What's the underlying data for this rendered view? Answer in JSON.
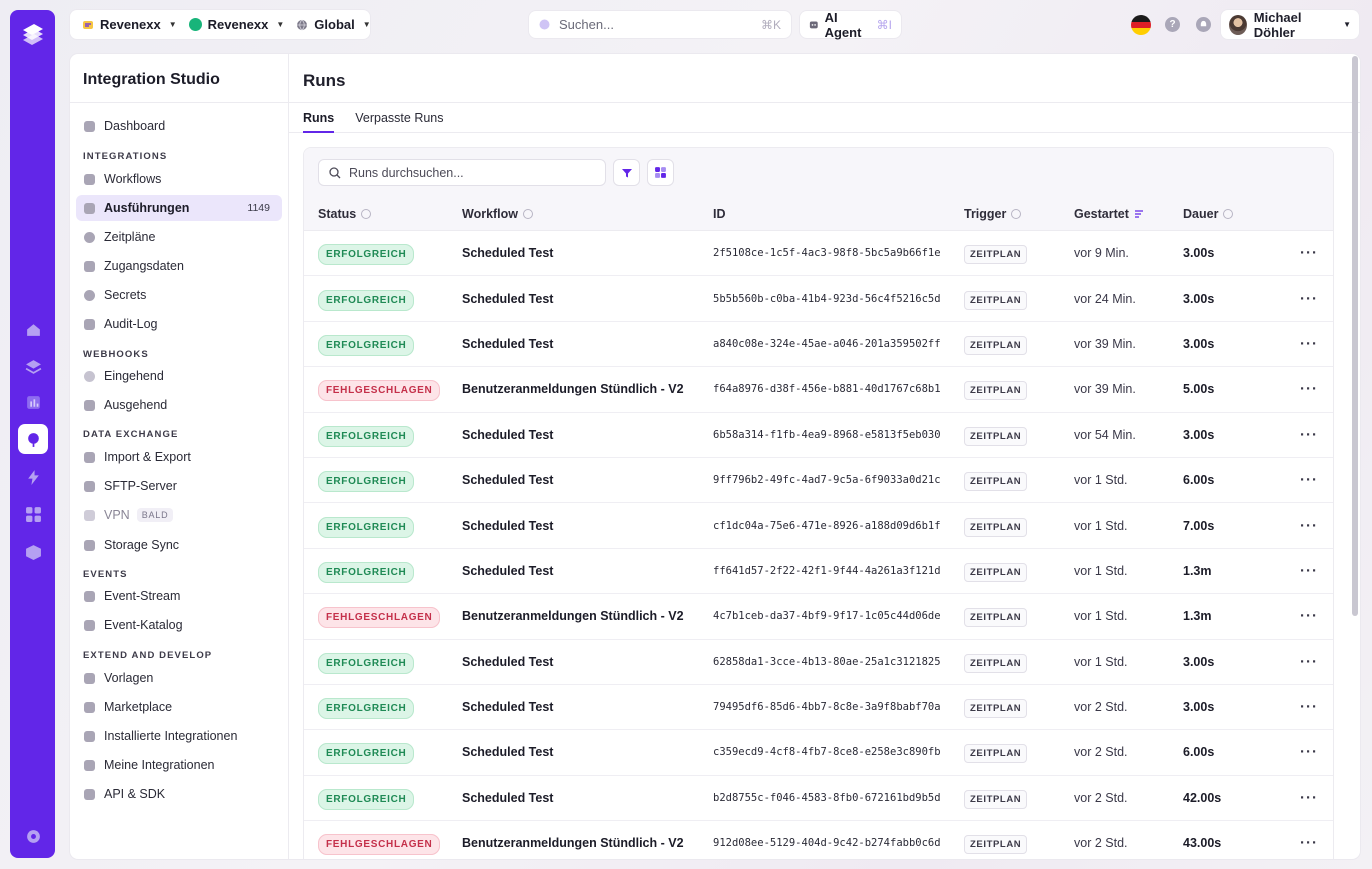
{
  "topbar": {
    "org1": "Revenexx",
    "org2": "Revenexx",
    "region": "Global",
    "search_placeholder": "Suchen...",
    "search_shortcut": "⌘K",
    "ai_label": "AI Agent",
    "ai_shortcut": "⌘I",
    "user_name": "Michael Döhler"
  },
  "sidebar": {
    "title": "Integration Studio",
    "dashboard": "Dashboard",
    "groups": {
      "integrations": "INTEGRATIONS",
      "webhooks": "WEBHOOKS",
      "data_exchange": "DATA EXCHANGE",
      "events": "EVENTS",
      "extend": "EXTEND AND DEVELOP"
    },
    "items": {
      "workflows": "Workflows",
      "ausfuehrungen": "Ausführungen",
      "ausfuehrungen_count": "1149",
      "zeitplaene": "Zeitpläne",
      "zugangsdaten": "Zugangsdaten",
      "secrets": "Secrets",
      "audit": "Audit-Log",
      "eingehend": "Eingehend",
      "ausgehend": "Ausgehend",
      "import_export": "Import & Export",
      "sftp": "SFTP-Server",
      "vpn": "VPN",
      "vpn_badge": "BALD",
      "storage": "Storage Sync",
      "event_stream": "Event-Stream",
      "event_katalog": "Event-Katalog",
      "vorlagen": "Vorlagen",
      "marketplace": "Marketplace",
      "installiert": "Installierte Integrationen",
      "meine": "Meine Integrationen",
      "api": "API & SDK"
    }
  },
  "main": {
    "title": "Runs",
    "tabs": [
      "Runs",
      "Verpasste Runs"
    ],
    "search_placeholder": "Runs durchsuchen...",
    "columns": [
      "Status",
      "Workflow",
      "ID",
      "Trigger",
      "Gestartet",
      "Dauer"
    ],
    "rows": [
      {
        "status": "ERFOLGREICH",
        "ok": true,
        "workflow": "Scheduled Test",
        "id": "2f5108ce-1c5f-4ac3-98f8-5bc5a9b66f1e",
        "trigger": "ZEITPLAN",
        "started": "vor 9 Min.",
        "duration": "3.00s"
      },
      {
        "status": "ERFOLGREICH",
        "ok": true,
        "workflow": "Scheduled Test",
        "id": "5b5b560b-c0ba-41b4-923d-56c4f5216c5d",
        "trigger": "ZEITPLAN",
        "started": "vor 24 Min.",
        "duration": "3.00s"
      },
      {
        "status": "ERFOLGREICH",
        "ok": true,
        "workflow": "Scheduled Test",
        "id": "a840c08e-324e-45ae-a046-201a359502ff",
        "trigger": "ZEITPLAN",
        "started": "vor 39 Min.",
        "duration": "3.00s"
      },
      {
        "status": "FEHLGESCHLAGEN",
        "ok": false,
        "workflow": "Benutzeranmeldungen Stündlich - V2",
        "id": "f64a8976-d38f-456e-b881-40d1767c68b1",
        "trigger": "ZEITPLAN",
        "started": "vor 39 Min.",
        "duration": "5.00s"
      },
      {
        "status": "ERFOLGREICH",
        "ok": true,
        "workflow": "Scheduled Test",
        "id": "6b58a314-f1fb-4ea9-8968-e5813f5eb030",
        "trigger": "ZEITPLAN",
        "started": "vor 54 Min.",
        "duration": "3.00s"
      },
      {
        "status": "ERFOLGREICH",
        "ok": true,
        "workflow": "Scheduled Test",
        "id": "9ff796b2-49fc-4ad7-9c5a-6f9033a0d21c",
        "trigger": "ZEITPLAN",
        "started": "vor 1 Std.",
        "duration": "6.00s"
      },
      {
        "status": "ERFOLGREICH",
        "ok": true,
        "workflow": "Scheduled Test",
        "id": "cf1dc04a-75e6-471e-8926-a188d09d6b1f",
        "trigger": "ZEITPLAN",
        "started": "vor 1 Std.",
        "duration": "7.00s"
      },
      {
        "status": "ERFOLGREICH",
        "ok": true,
        "workflow": "Scheduled Test",
        "id": "ff641d57-2f22-42f1-9f44-4a261a3f121d",
        "trigger": "ZEITPLAN",
        "started": "vor 1 Std.",
        "duration": "1.3m"
      },
      {
        "status": "FEHLGESCHLAGEN",
        "ok": false,
        "workflow": "Benutzeranmeldungen Stündlich - V2",
        "id": "4c7b1ceb-da37-4bf9-9f17-1c05c44d06de",
        "trigger": "ZEITPLAN",
        "started": "vor 1 Std.",
        "duration": "1.3m"
      },
      {
        "status": "ERFOLGREICH",
        "ok": true,
        "workflow": "Scheduled Test",
        "id": "62858da1-3cce-4b13-80ae-25a1c3121825",
        "trigger": "ZEITPLAN",
        "started": "vor 1 Std.",
        "duration": "3.00s"
      },
      {
        "status": "ERFOLGREICH",
        "ok": true,
        "workflow": "Scheduled Test",
        "id": "79495df6-85d6-4bb7-8c8e-3a9f8babf70a",
        "trigger": "ZEITPLAN",
        "started": "vor 2 Std.",
        "duration": "3.00s"
      },
      {
        "status": "ERFOLGREICH",
        "ok": true,
        "workflow": "Scheduled Test",
        "id": "c359ecd9-4cf8-4fb7-8ce8-e258e3c890fb",
        "trigger": "ZEITPLAN",
        "started": "vor 2 Std.",
        "duration": "6.00s"
      },
      {
        "status": "ERFOLGREICH",
        "ok": true,
        "workflow": "Scheduled Test",
        "id": "b2d8755c-f046-4583-8fb0-672161bd9b5d",
        "trigger": "ZEITPLAN",
        "started": "vor 2 Std.",
        "duration": "42.00s"
      },
      {
        "status": "FEHLGESCHLAGEN",
        "ok": false,
        "workflow": "Benutzeranmeldungen Stündlich - V2",
        "id": "912d08ee-5129-404d-9c42-b274fabb0c6d",
        "trigger": "ZEITPLAN",
        "started": "vor 2 Std.",
        "duration": "43.00s"
      }
    ],
    "more_glyph": "···"
  },
  "colors": {
    "brand": "#6226e8",
    "success": "#1f8a55",
    "failure": "#c4304a"
  },
  "icons": [
    "logo-icon",
    "home-icon",
    "layers-icon",
    "chart-icon",
    "integrations-icon",
    "bolt-icon",
    "grid-icon",
    "cube-icon",
    "settings-icon",
    "search-icon",
    "filter-icon",
    "columns-icon",
    "help-icon",
    "bell-icon"
  ]
}
